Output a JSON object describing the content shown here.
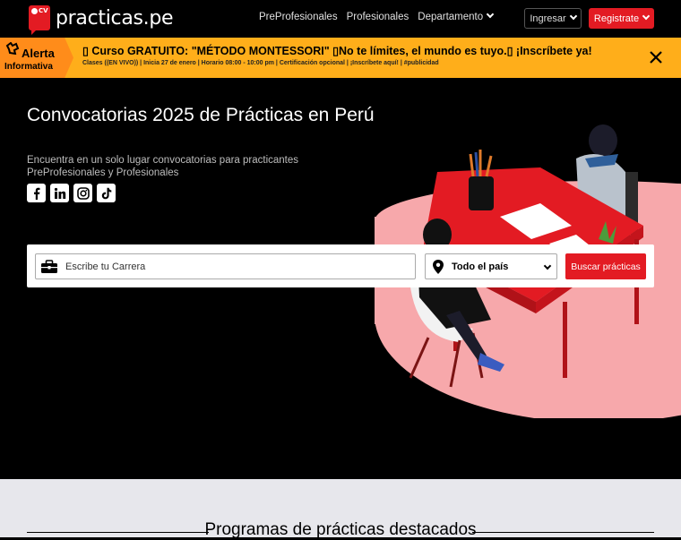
{
  "nav": {
    "logo_badge": "CV",
    "logo_text": "practicas.pe",
    "links": [
      "PreProfesionales",
      "Profesionales",
      "Departamento"
    ],
    "login_label": "Ingresar",
    "register_label": "Registrate"
  },
  "alert": {
    "tag_title": "Alerta",
    "tag_sub": "Informativa",
    "message": "▯ Curso GRATUITO: \"MÉTODO MONTESSORI\" ▯No te límites, el mundo es tuyo.▯ ¡Inscríbete ya!",
    "details": "Clases ((EN VIVO)) | Inicia 27 de enero | Horario 08:00 - 10:00 pm | Certificación opcional | ¡Inscríbete aquí! | #publicidad"
  },
  "hero": {
    "title": "Convocatorias 2025 de Prácticas en Perú",
    "subtitle": "Encuentra en un solo lugar convocatorias para practicantes PreProfesionales y Profesionales",
    "social": [
      "facebook-icon",
      "linkedin-icon",
      "instagram-icon",
      "tiktok-icon"
    ]
  },
  "search": {
    "placeholder": "Escribe tu Carrera",
    "location_selected": "Todo el país",
    "button_label": "Buscar prácticas"
  },
  "featured": {
    "title": "Programas de prácticas destacados"
  },
  "colors": {
    "brand_red": "#e31b23",
    "alert_yellow": "#ffae1a",
    "alert_tag": "#ff8c1a"
  }
}
